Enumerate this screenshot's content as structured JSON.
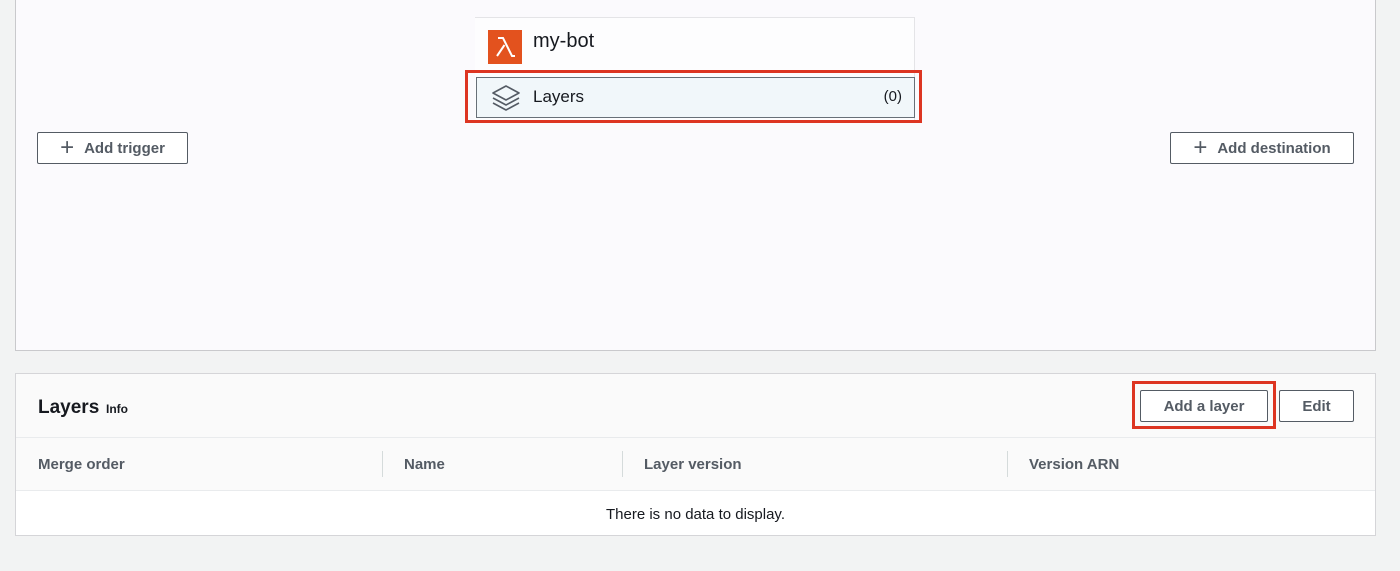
{
  "designer": {
    "function_name": "my-bot",
    "layers_label": "Layers",
    "layers_count": "(0)",
    "add_trigger_label": "Add trigger",
    "add_destination_label": "Add destination",
    "lambda_icon": "lambda-icon",
    "layers_icon": "layers-stack-icon",
    "accent_color": "#e3521e",
    "highlight_color": "#dd3522"
  },
  "layers_panel": {
    "title": "Layers",
    "info_label": "Info",
    "add_layer_label": "Add a layer",
    "edit_label": "Edit",
    "columns": [
      "Merge order",
      "Name",
      "Layer version",
      "Version ARN"
    ],
    "empty_message": "There is no data to display."
  }
}
